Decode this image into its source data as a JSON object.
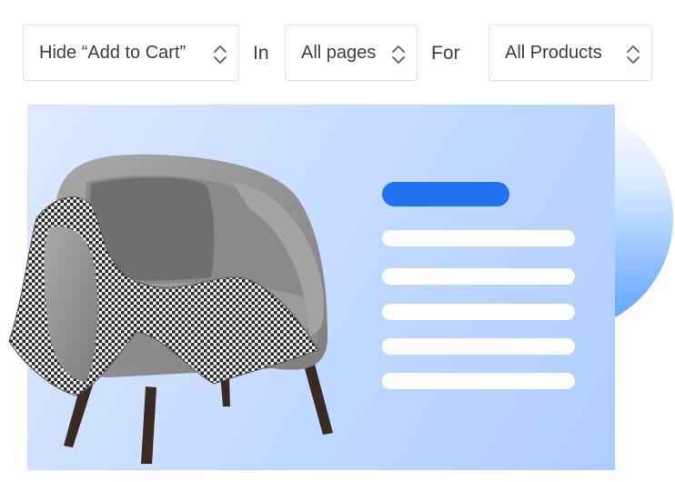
{
  "filters": {
    "action": "Hide “Add to Cart”",
    "connector_in": "In",
    "scope": "All pages",
    "connector_for": "For",
    "target": "All Products"
  }
}
